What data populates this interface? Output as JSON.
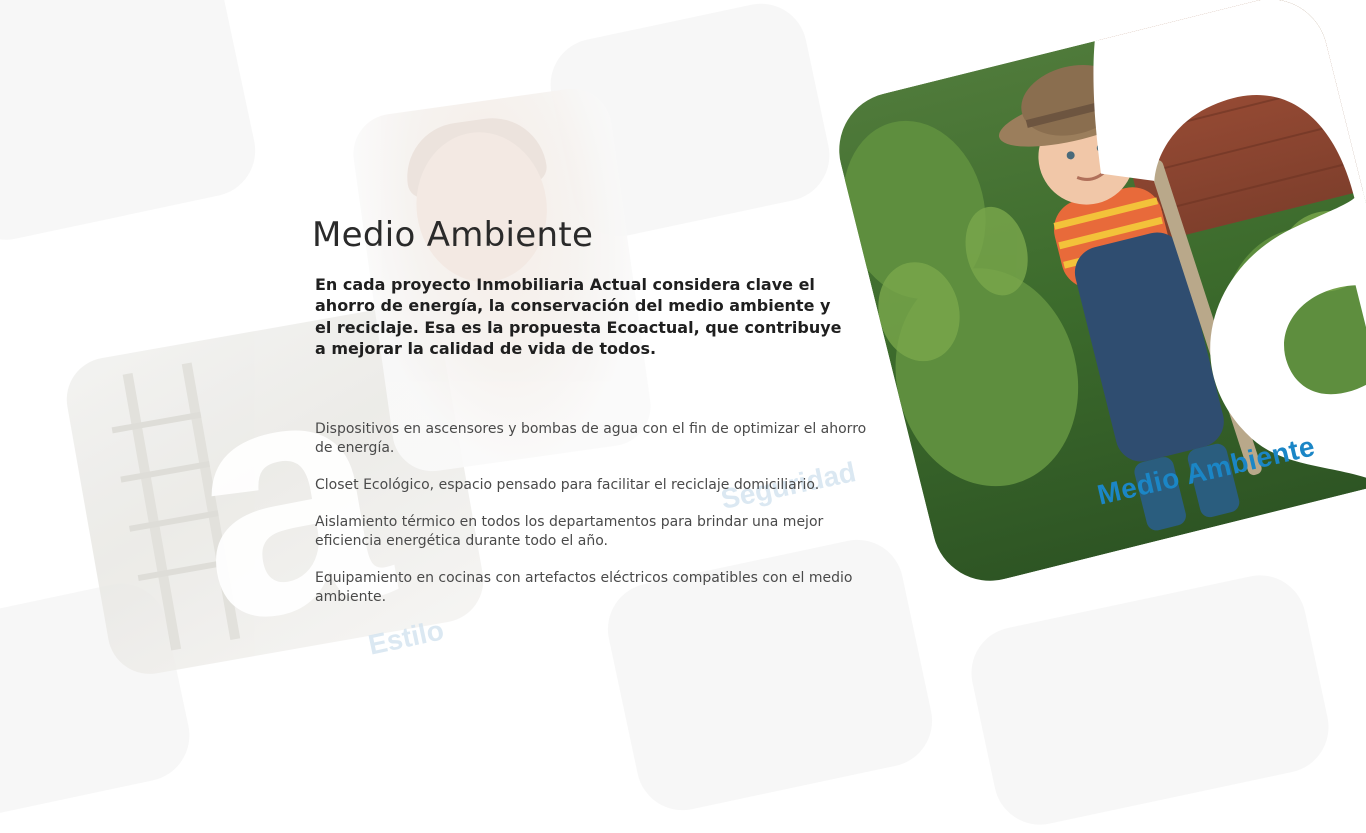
{
  "section": {
    "title": "Medio Ambiente",
    "intro": "En cada proyecto Inmobiliaria Actual considera clave el ahorro de energía, la conservación del medio ambiente y el reciclaje. Esa es la propuesta Ecoactual, que contribuye a mejorar la calidad de vida de todos.",
    "features": [
      "Dispositivos en ascensores y bombas de agua con el fin de optimizar el ahorro de energía.",
      "Closet Ecológico, espacio pensado para facilitar el reciclaje domiciliario.",
      "Aislamiento térmico en todos los departamentos para brindar una mejor eficiencia energética durante todo el año.",
      "Equipamiento en cocinas con artefactos eléctricos compatibles con el medio ambiente."
    ]
  },
  "hero": {
    "badge_label": "Medio Ambiente",
    "letter": "a"
  },
  "background": {
    "words": [
      "Seguridad",
      "Estilo"
    ]
  },
  "colors": {
    "accent": "#1b86c6",
    "text_dark": "#1f1f1f",
    "text_body": "#4a4a4a"
  }
}
